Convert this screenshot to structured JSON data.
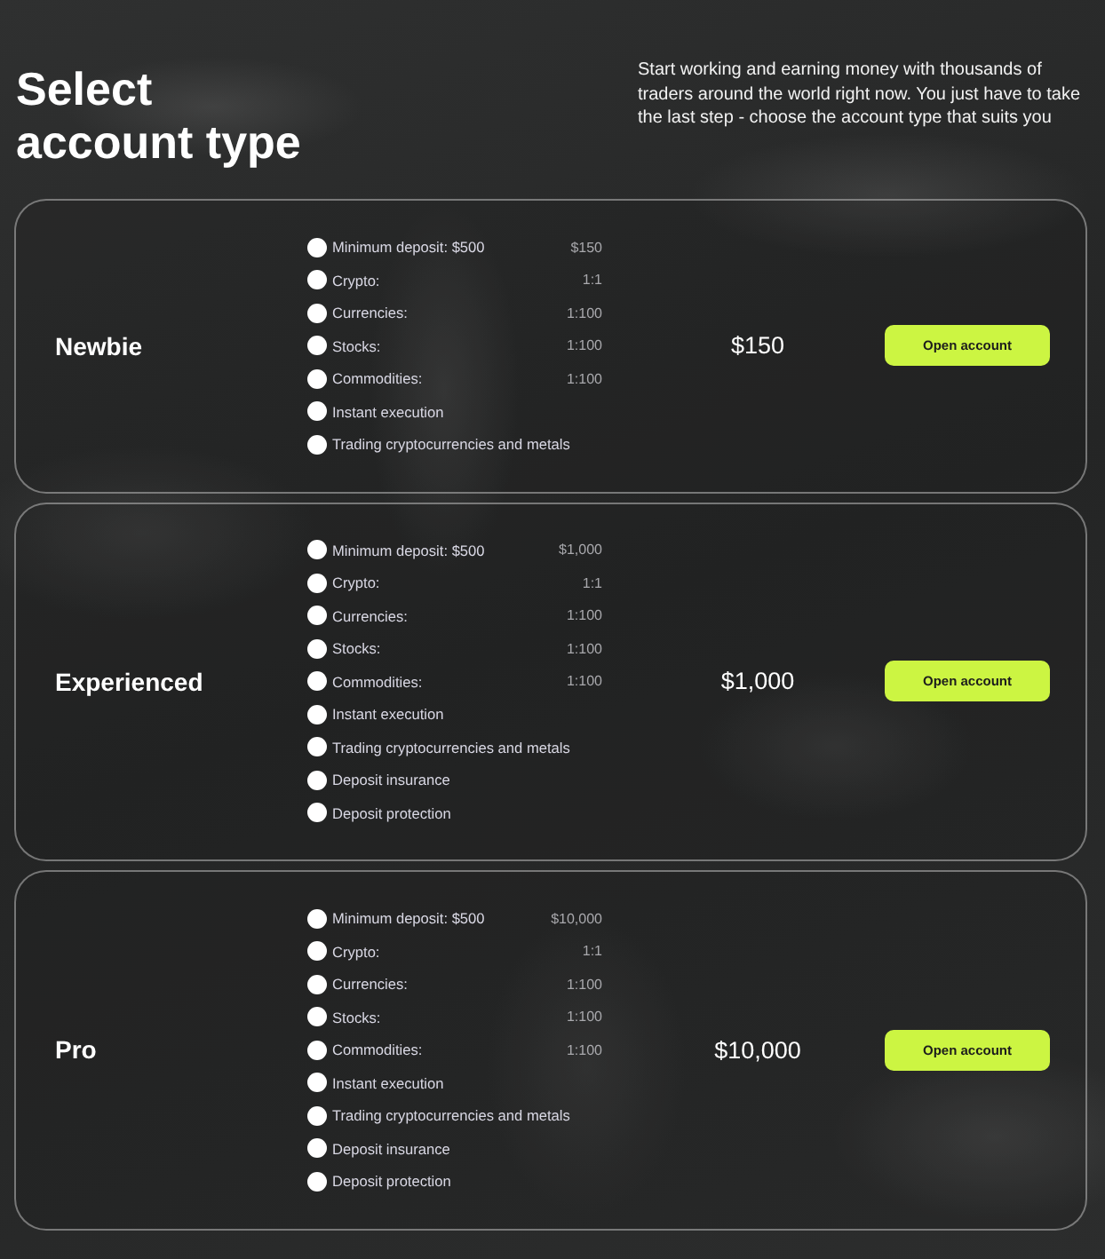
{
  "header": {
    "title": "Select account type",
    "description": "Start working and earning money with thousands of traders around the world right now. You just have to take the last step - choose the account type that suits you"
  },
  "plans": [
    {
      "name": "Newbie",
      "price": "$150",
      "button": "Open account",
      "features": [
        {
          "label": "Minimum deposit: $500",
          "value": "$150"
        },
        {
          "label": "Crypto:",
          "value": "1:1"
        },
        {
          "label": "Currencies:",
          "value": "1:100"
        },
        {
          "label": "Stocks:",
          "value": "1:100"
        },
        {
          "label": "Commodities:",
          "value": "1:100"
        },
        {
          "label": "Instant execution"
        },
        {
          "label": "Trading cryptocurrencies and metals"
        }
      ]
    },
    {
      "name": "Experienced",
      "price": "$1,000",
      "button": "Open account",
      "features": [
        {
          "label": "Minimum deposit: $500",
          "value": "$1,000"
        },
        {
          "label": "Crypto:",
          "value": "1:1"
        },
        {
          "label": "Currencies:",
          "value": "1:100"
        },
        {
          "label": "Stocks:",
          "value": "1:100"
        },
        {
          "label": "Commodities:",
          "value": "1:100"
        },
        {
          "label": "Instant execution"
        },
        {
          "label": "Trading cryptocurrencies and metals"
        },
        {
          "label": "Deposit insurance"
        },
        {
          "label": "Deposit protection"
        }
      ]
    },
    {
      "name": "Pro",
      "price": "$10,000",
      "button": "Open account",
      "features": [
        {
          "label": "Minimum deposit: $500",
          "value": "$10,000"
        },
        {
          "label": "Crypto:",
          "value": "1:1"
        },
        {
          "label": "Currencies:",
          "value": "1:100"
        },
        {
          "label": "Stocks:",
          "value": "1:100"
        },
        {
          "label": "Commodities:",
          "value": "1:100"
        },
        {
          "label": "Instant execution"
        },
        {
          "label": "Trading cryptocurrencies and metals"
        },
        {
          "label": "Deposit insurance"
        },
        {
          "label": "Deposit protection"
        }
      ]
    }
  ]
}
